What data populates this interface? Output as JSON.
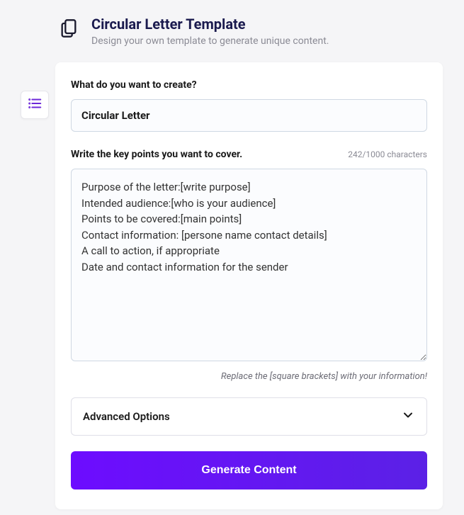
{
  "header": {
    "title": "Circular Letter Template",
    "subtitle": "Design your own template to generate unique content."
  },
  "form": {
    "create_label": "What do you want to create?",
    "create_value": "Circular Letter",
    "keypoints_label": "Write the key points you want to cover.",
    "char_count": "242/1000 characters",
    "keypoints_value": "Purpose of the letter:[write purpose]\nIntended audience:[who is your audience]\nPoints to be covered:[main points]\nContact information: [persone name contact details]\nA call to action, if appropriate\nDate and contact information for the sender",
    "hint": "Replace the [square brackets] with your information!",
    "advanced_label": "Advanced Options",
    "generate_label": "Generate Content"
  }
}
